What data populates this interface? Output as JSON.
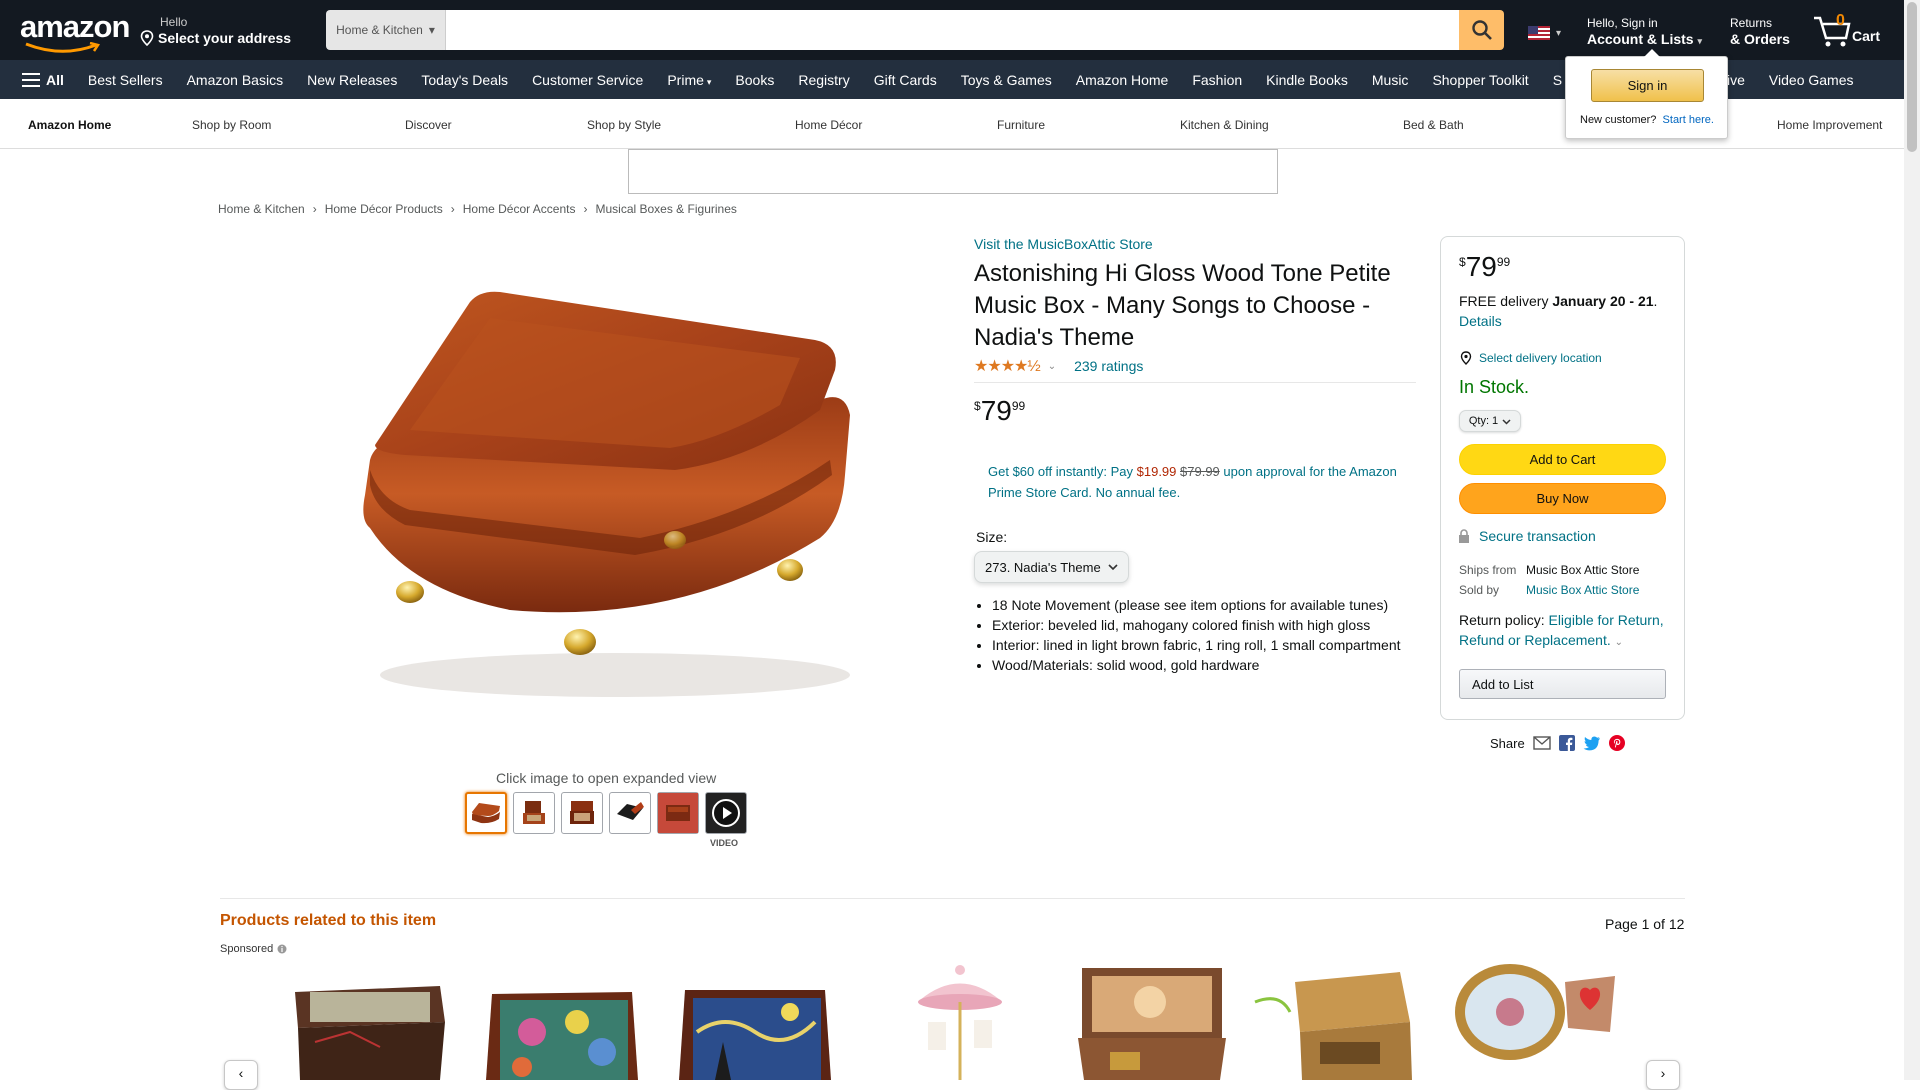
{
  "header": {
    "logo": "amazon",
    "deliver_hello": "Hello",
    "deliver_address": "Select your address",
    "search_category": "Home & Kitchen",
    "search_value": "",
    "account_hello": "Hello, Sign in",
    "account_lists": "Account & Lists",
    "returns": "Returns",
    "orders": "& Orders",
    "cart_count": "0",
    "cart_label": "Cart"
  },
  "subnav": {
    "all_label": "All",
    "items": [
      "Best Sellers",
      "Amazon Basics",
      "New Releases",
      "Today's Deals",
      "Customer Service",
      "Prime",
      "Books",
      "Registry",
      "Gift Cards",
      "Toys & Games",
      "Amazon Home",
      "Fashion",
      "Kindle Books",
      "Music",
      "Shopper Toolkit",
      "S",
      "motive",
      "Video Games"
    ]
  },
  "store_nav": [
    "Amazon Home",
    "Shop by Room",
    "Discover",
    "Shop by Style",
    "Home Décor",
    "Furniture",
    "Kitchen & Dining",
    "Bed & Bath",
    "Home Improvement"
  ],
  "popover": {
    "sign_in": "Sign in",
    "new_customer": "New customer?",
    "start_here": "Start here."
  },
  "breadcrumbs": [
    "Home & Kitchen",
    "Home Décor Products",
    "Home Décor Accents",
    "Musical Boxes & Figurines"
  ],
  "gallery": {
    "expand_note": "Click image to open expanded view",
    "video_label": "VIDEO",
    "selected_thumb": 0
  },
  "product": {
    "store_link": "Visit the MusicBoxAttic Store",
    "title": "Astonishing Hi Gloss Wood Tone Petite Music Box - Many Songs to Choose - Nadia's Theme",
    "stars": "★★★★½",
    "ratings": "239 ratings",
    "price_symbol": "$",
    "price_whole": "79",
    "price_fraction": "99",
    "promo_a": "Get $60 off instantly: Pay ",
    "promo_price": "$19.99",
    "promo_strike": "$79.99",
    "promo_b": " upon approval for the Amazon Prime Store Card. No annual fee.",
    "size_label": "Size:",
    "size_value": "273. Nadia's Theme",
    "bullets": [
      "18 Note Movement (please see item options for available tunes)",
      "Exterior: beveled lid, mahogany colored finish with high gloss",
      "Interior: lined in light brown fabric, 1 ring roll, 1 small compartment",
      "Wood/Materials: solid wood, gold hardware"
    ]
  },
  "buybox": {
    "price_symbol": "$",
    "price_whole": "79",
    "price_fraction": "99",
    "delivery_prefix": "FREE delivery ",
    "delivery_dates": "January 20 - 21",
    "details": "Details",
    "location": "Select delivery location",
    "stock": "In Stock.",
    "qty": "Qty: 1",
    "add_to_cart": "Add to Cart",
    "buy_now": "Buy Now",
    "secure": "Secure transaction",
    "ships_from_label": "Ships from",
    "ships_from": "Music Box Attic Store",
    "sold_by_label": "Sold by",
    "sold_by": "Music Box Attic Store",
    "return_label": "Return policy: ",
    "return_link": "Eligible for Return, Refund or Replacement.",
    "add_to_list": "Add to List"
  },
  "share": {
    "label": "Share"
  },
  "related": {
    "title": "Products related to this item",
    "sponsored": "Sponsored",
    "page": "Page 1 of 12"
  },
  "colors": {
    "nav": "#131921",
    "subnav": "#232f3e",
    "link": "#007185",
    "cart_btn": "#ffd814",
    "buy_btn": "#ffa41c",
    "instock": "#007600",
    "related_title": "#c45500"
  }
}
